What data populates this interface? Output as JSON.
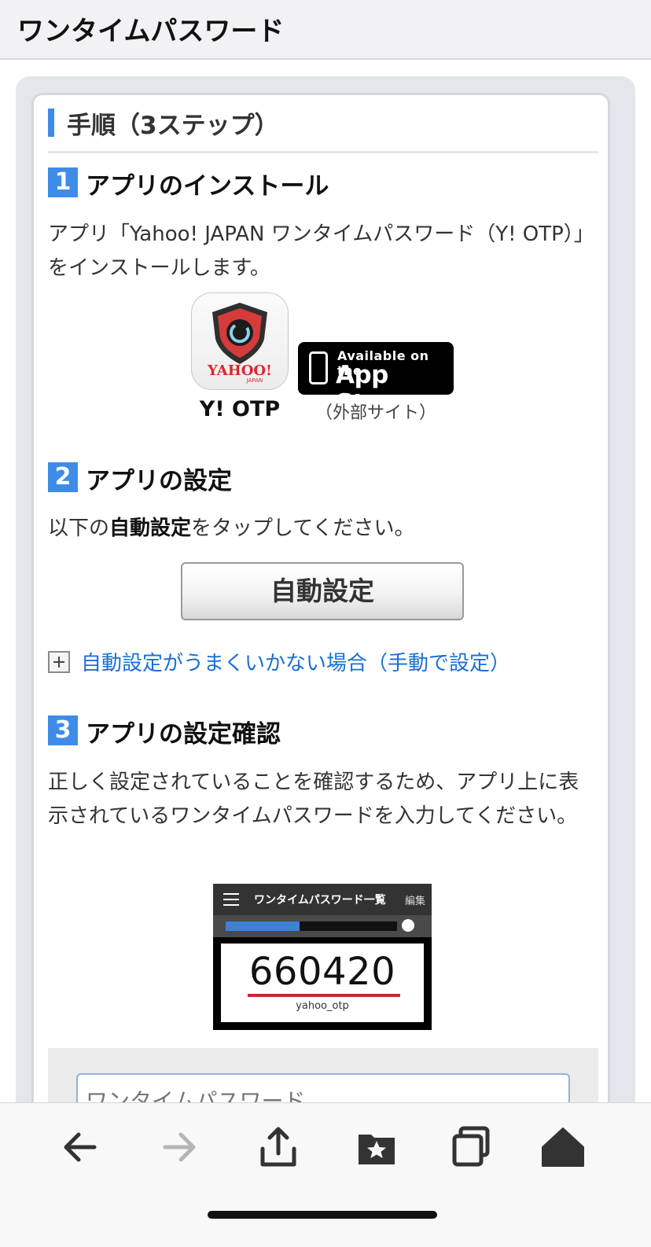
{
  "header": {
    "title": "ワンタイムパスワード"
  },
  "section": {
    "title": "手順（3ステップ）"
  },
  "step1": {
    "number": "1",
    "title": "アプリのインストール",
    "desc": "アプリ「Yahoo! JAPAN ワンタイムパスワード（Y! OTP）」をインストールします。",
    "app_name": "Y! OTP",
    "app_icon_text": "YAHOO!",
    "app_icon_sub": "JAPAN",
    "appstore_small": "Available on the",
    "appstore_big": "App Store",
    "external_note": "（外部サイト）"
  },
  "step2": {
    "number": "2",
    "title": "アプリの設定",
    "desc_prefix": "以下の",
    "desc_bold": "自動設定",
    "desc_suffix": "をタップしてください。",
    "button_label": "自動設定",
    "manual_link": "自動設定がうまくいかない場合（手動で設定）"
  },
  "step3": {
    "number": "3",
    "title": "アプリの設定確認",
    "desc": "正しく設定されていることを確認するため、アプリ上に表示されているワンタイムパスワードを入力してください。",
    "screenshot": {
      "list_title": "ワンタイムパスワード一覧",
      "edit_label": "編集",
      "progress": 0.43,
      "code": "660420",
      "account": "yahoo_otp"
    },
    "input_placeholder": "ワンタイムパスワード"
  },
  "toolbar": {
    "icons": [
      "back-arrow-icon",
      "forward-arrow-icon",
      "share-icon",
      "bookmarks-icon",
      "tabs-icon",
      "home-icon"
    ]
  },
  "colors": {
    "accent": "#3e8ce8",
    "link": "#1a6fd4",
    "otp_underline": "#c9282d"
  }
}
